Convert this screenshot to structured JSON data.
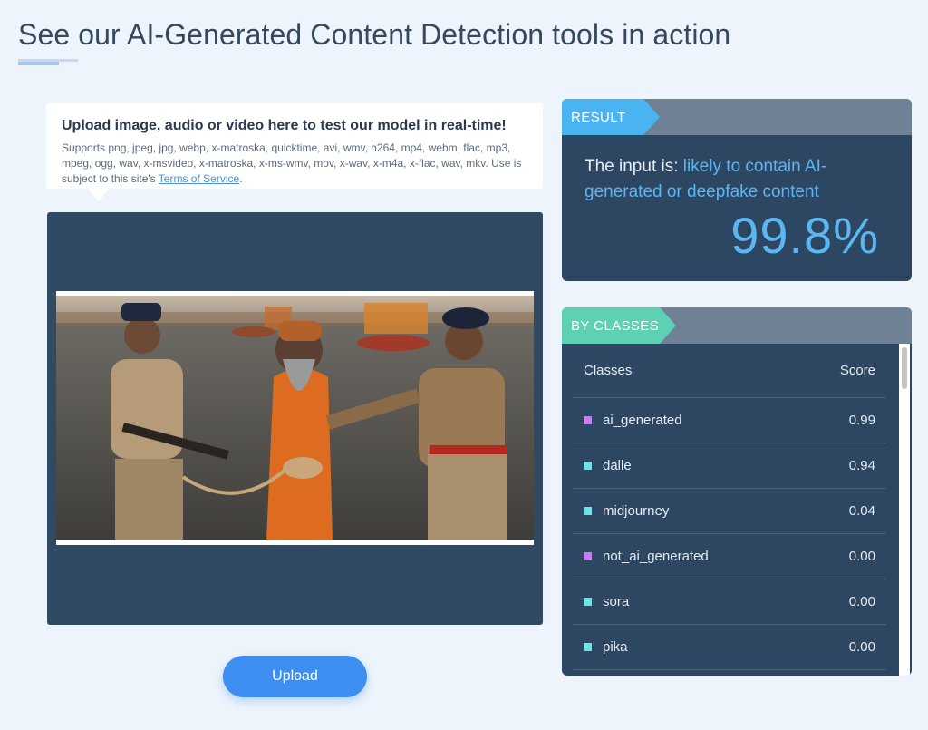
{
  "page": {
    "heading": "See our AI-Generated Content Detection tools in action"
  },
  "upload_card": {
    "title": "Upload image, audio or video here to test our model in real-time!",
    "supports": "Supports png, jpeg, jpg, webp, x-matroska, quicktime, avi, wmv, h264, mp4, webm, flac, mp3, mpeg, ogg, wav, x-msvideo, x-matroska, x-ms-wmv, mov, x-wav, x-m4a, x-flac, wav, mkv. Use is subject to this site's ",
    "tos_link": "Terms of Service",
    "tos_end": "."
  },
  "upload_button": {
    "label": "Upload"
  },
  "result": {
    "tag": "RESULT",
    "prefix": "The input is: ",
    "verdict": "likely to contain AI-generated or deepfake content",
    "score": "99.8%"
  },
  "classes": {
    "tag": "BY CLASSES",
    "col_class": "Classes",
    "col_score": "Score",
    "rows": [
      {
        "name": "ai_generated",
        "score": "0.99",
        "color": "#c77ef0"
      },
      {
        "name": "dalle",
        "score": "0.94",
        "color": "#6fe2e8"
      },
      {
        "name": "midjourney",
        "score": "0.04",
        "color": "#6fe2e8"
      },
      {
        "name": "not_ai_generated",
        "score": "0.00",
        "color": "#c77ef0"
      },
      {
        "name": "sora",
        "score": "0.00",
        "color": "#6fe2e8"
      },
      {
        "name": "pika",
        "score": "0.00",
        "color": "#6fe2e8"
      }
    ]
  },
  "colors": {
    "panel_bg": "#2d4661",
    "accent_blue": "#4ab4f0",
    "accent_green": "#5ed1b5",
    "button_blue": "#3d8ef0"
  }
}
